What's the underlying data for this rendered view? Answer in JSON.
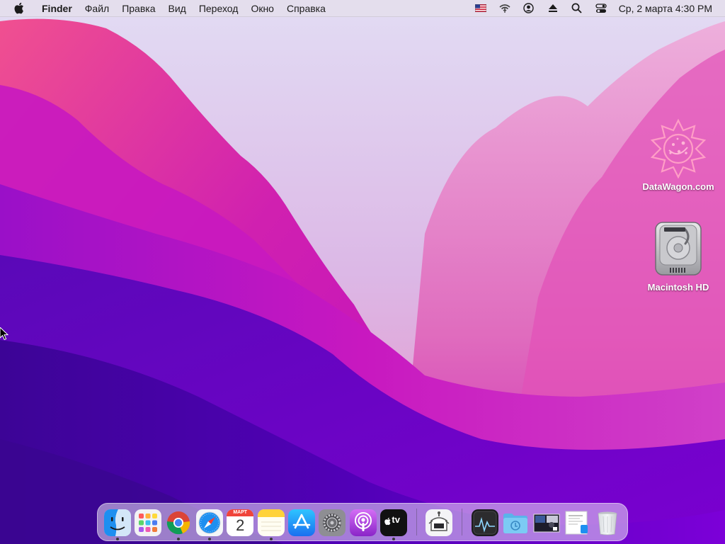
{
  "menubar": {
    "app_name": "Finder",
    "menus": [
      "Файл",
      "Правка",
      "Вид",
      "Переход",
      "Окно",
      "Справка"
    ],
    "status_icons": [
      "us-flag-input-icon",
      "wifi-icon",
      "user-icon",
      "eject-icon",
      "spotlight-search-icon",
      "control-center-icon"
    ],
    "clock": "Ср, 2 марта  4:30 PM"
  },
  "desktop": {
    "icons": [
      {
        "label": "DataWagon.com",
        "icon": "datawagon-logo-icon"
      },
      {
        "label": "Macintosh HD",
        "icon": "hard-drive-icon"
      }
    ]
  },
  "dock": {
    "apps": [
      {
        "name": "Finder",
        "icon": "finder-icon",
        "running": true
      },
      {
        "name": "Launchpad",
        "icon": "launchpad-icon",
        "running": false
      },
      {
        "name": "Google Chrome",
        "icon": "chrome-icon",
        "running": true
      },
      {
        "name": "Safari",
        "icon": "safari-icon",
        "running": true
      },
      {
        "name": "Календарь",
        "icon": "calendar-icon",
        "running": false,
        "month": "МАРТ",
        "day": "2"
      },
      {
        "name": "Заметки",
        "icon": "notes-icon",
        "running": true
      },
      {
        "name": "App Store",
        "icon": "app-store-icon",
        "running": false
      },
      {
        "name": "Системные настройки",
        "icon": "system-preferences-icon",
        "running": false
      },
      {
        "name": "Подкасты",
        "icon": "podcasts-icon",
        "running": false
      },
      {
        "name": "TV",
        "icon": "apple-tv-icon",
        "running": true,
        "text": "tv"
      }
    ],
    "utilities": [
      {
        "name": "Ассистент миграции",
        "icon": "migration-assistant-icon"
      }
    ],
    "stacks": [
      {
        "name": "Мониторинг системы",
        "icon": "activity-monitor-icon"
      },
      {
        "name": "Загрузки",
        "icon": "downloads-folder-icon"
      },
      {
        "name": "Недавние",
        "icon": "screenshot-stack-icon"
      },
      {
        "name": "Документы",
        "icon": "document-preview-icon"
      },
      {
        "name": "Корзина",
        "icon": "trash-icon"
      }
    ]
  },
  "colors": {
    "menubar_bg": "#e4deec",
    "wallpaper_top": "#d8c8f2",
    "wallpaper_magenta": "#c817b6",
    "wallpaper_purple": "#6a00c8"
  }
}
